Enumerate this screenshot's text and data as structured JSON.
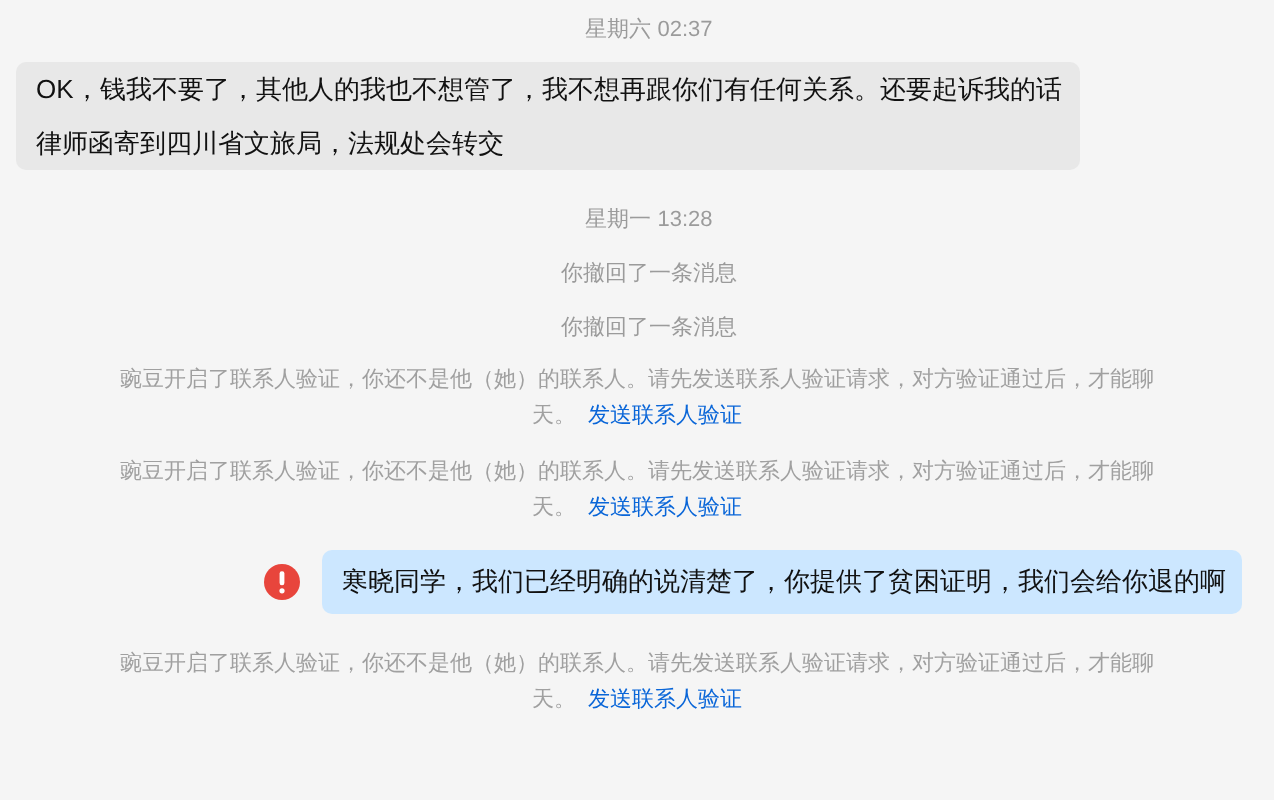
{
  "messages": [
    {
      "kind": "time",
      "text": "星期六 02:37"
    },
    {
      "kind": "incoming",
      "text": "OK，钱我不要了，其他人的我也不想管了，我不想再跟你们有任何关系。还要起诉我的话律师函寄到四川省文旅局，法规处会转交"
    },
    {
      "kind": "time",
      "text": "星期一 13:28"
    },
    {
      "kind": "recalled",
      "text": "你撤回了一条消息"
    },
    {
      "kind": "recalled",
      "text": "你撤回了一条消息"
    },
    {
      "kind": "system",
      "text": "豌豆开启了联系人验证，你还不是他（她）的联系人。请先发送联系人验证请求，对方验证通过后，才能聊天。",
      "link": "发送联系人验证"
    },
    {
      "kind": "system",
      "text": "豌豆开启了联系人验证，你还不是他（她）的联系人。请先发送联系人验证请求，对方验证通过后，才能聊天。",
      "link": "发送联系人验证"
    },
    {
      "kind": "outgoing",
      "text": "寒晓同学，我们已经明确的说清楚了，你提供了贫困证明，我们会给你退的啊",
      "failed": true
    },
    {
      "kind": "system",
      "text": "豌豆开启了联系人验证，你还不是他（她）的联系人。请先发送联系人验证请求，对方验证通过后，才能聊天。",
      "link": "发送联系人验证"
    }
  ]
}
